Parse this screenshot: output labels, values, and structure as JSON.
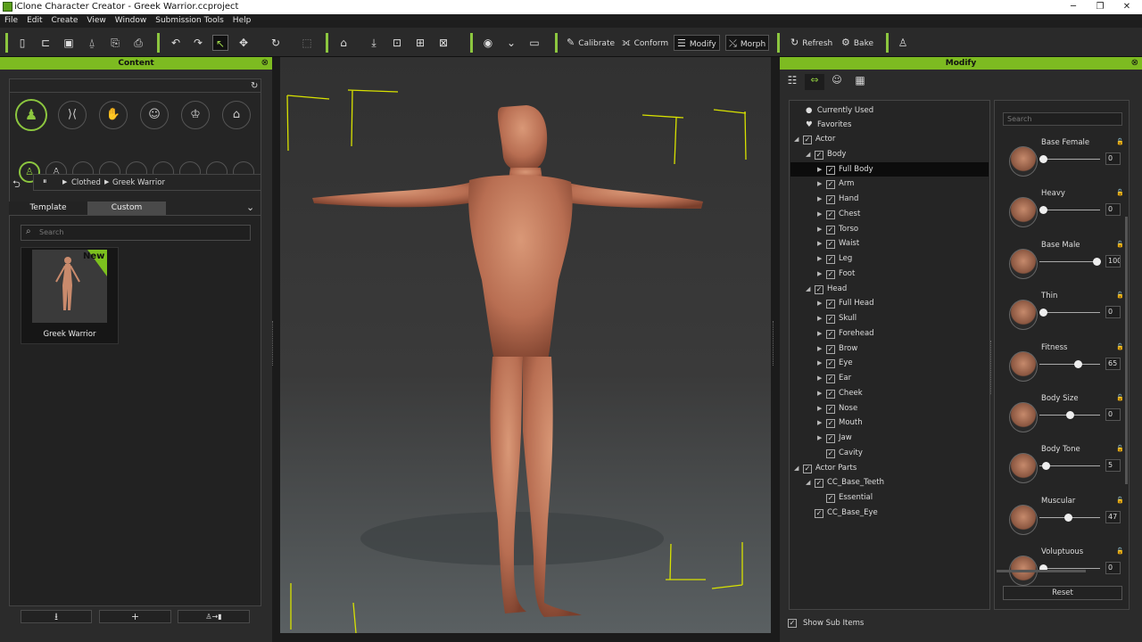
{
  "window": {
    "title": "iClone Character Creator - Greek Warrior.ccproject",
    "controls": [
      "─",
      "❐",
      "✕"
    ]
  },
  "menu": [
    "File",
    "Edit",
    "Create",
    "View",
    "Window",
    "Submission Tools",
    "Help"
  ],
  "toolbar": {
    "calibrate": "Calibrate",
    "conform": "Conform",
    "modify": "Modify",
    "morph": "Morph",
    "refresh": "Refresh",
    "bake": "Bake"
  },
  "content": {
    "title": "Content",
    "breadcrumb": [
      "Clothed",
      "Greek Warrior"
    ],
    "tabs": [
      "Template",
      "Custom"
    ],
    "active_tab": "Custom",
    "search_placeholder": "Search",
    "items": [
      {
        "label": "Greek Warrior",
        "badge": "New"
      }
    ]
  },
  "modify": {
    "title": "Modify",
    "special": [
      "Currently Used",
      "Favorites"
    ],
    "tree": [
      {
        "label": "Actor",
        "level": 0,
        "arrow": "open"
      },
      {
        "label": "Body",
        "level": 1,
        "arrow": "open"
      },
      {
        "label": "Full Body",
        "level": 2,
        "arrow": "closed",
        "selected": true
      },
      {
        "label": "Arm",
        "level": 2,
        "arrow": "closed"
      },
      {
        "label": "Hand",
        "level": 2,
        "arrow": "closed"
      },
      {
        "label": "Chest",
        "level": 2,
        "arrow": "closed"
      },
      {
        "label": "Torso",
        "level": 2,
        "arrow": "closed"
      },
      {
        "label": "Waist",
        "level": 2,
        "arrow": "closed"
      },
      {
        "label": "Leg",
        "level": 2,
        "arrow": "closed"
      },
      {
        "label": "Foot",
        "level": 2,
        "arrow": "closed"
      },
      {
        "label": "Head",
        "level": 1,
        "arrow": "open"
      },
      {
        "label": "Full Head",
        "level": 2,
        "arrow": "closed"
      },
      {
        "label": "Skull",
        "level": 2,
        "arrow": "closed"
      },
      {
        "label": "Forehead",
        "level": 2,
        "arrow": "closed"
      },
      {
        "label": "Brow",
        "level": 2,
        "arrow": "closed"
      },
      {
        "label": "Eye",
        "level": 2,
        "arrow": "closed"
      },
      {
        "label": "Ear",
        "level": 2,
        "arrow": "closed"
      },
      {
        "label": "Cheek",
        "level": 2,
        "arrow": "closed"
      },
      {
        "label": "Nose",
        "level": 2,
        "arrow": "closed"
      },
      {
        "label": "Mouth",
        "level": 2,
        "arrow": "closed"
      },
      {
        "label": "Jaw",
        "level": 2,
        "arrow": "closed"
      },
      {
        "label": "Cavity",
        "level": 2,
        "arrow": "none"
      },
      {
        "label": "Actor Parts",
        "level": 0,
        "arrow": "open"
      },
      {
        "label": "CC_Base_Teeth",
        "level": 1,
        "arrow": "open"
      },
      {
        "label": "Essential",
        "level": 2,
        "arrow": "none"
      },
      {
        "label": "CC_Base_Eye",
        "level": 1,
        "arrow": "none"
      }
    ],
    "show_sub_items": "Show Sub Items",
    "search_placeholder": "Search",
    "sliders": [
      {
        "name": "Base Female",
        "value": "0",
        "fraction": 0.0
      },
      {
        "name": "Heavy",
        "value": "0",
        "fraction": 0.0
      },
      {
        "name": "Base Male",
        "value": "100",
        "fraction": 1.0
      },
      {
        "name": "Thin",
        "value": "0",
        "fraction": 0.0
      },
      {
        "name": "Fitness",
        "value": "65",
        "fraction": 0.65
      },
      {
        "name": "Body Size",
        "value": "0",
        "fraction": 0.5
      },
      {
        "name": "Body Tone",
        "value": "5",
        "fraction": 0.05
      },
      {
        "name": "Muscular",
        "value": "47",
        "fraction": 0.47
      },
      {
        "name": "Voluptuous",
        "value": "0",
        "fraction": 0.0
      }
    ],
    "reset": "Reset"
  }
}
